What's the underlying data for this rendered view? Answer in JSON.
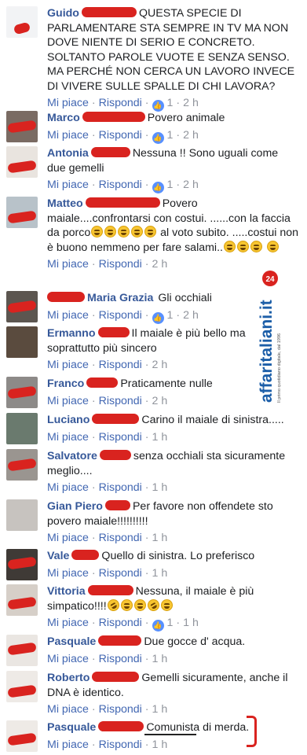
{
  "comments": [
    {
      "name": "Guido",
      "text": "QUESTA SPECIE DI PARLAMENTARE STA SEMPRE IN TV MA NON DOVE NIENTE DI SERIO E CONCRETO. SOLTANTO PAROLE VUOTE E SENZA SENSO. MA PERCHÉ NON CERCA UN LAVORO INVECE DI VIVERE SULLE SPALLE DI CHI LAVORA?",
      "like": "Mi piace",
      "reply": "Rispondi",
      "likes": "1",
      "time": "2 h"
    },
    {
      "name": "Marco",
      "text": "Povero animale",
      "like": "Mi piace",
      "reply": "Rispondi",
      "likes": "1",
      "time": "2 h"
    },
    {
      "name": "Antonia",
      "text": "Nessuna !! Sono uguali come due gemelli",
      "like": "Mi piace",
      "reply": "Rispondi",
      "likes": "1",
      "time": "2 h"
    },
    {
      "name": "Matteo",
      "text_a": "Povero maiale....confrontarsi con costui. ......con la faccia da porco",
      "text_b": "al voto subito. .....costui non è buono nemmeno per fare salami..",
      "like": "Mi piace",
      "reply": "Rispondi",
      "time": "2 h"
    },
    {
      "name": "Maria Grazia",
      "text": "Gli occhiali",
      "like": "Mi piace",
      "reply": "Rispondi",
      "likes": "1",
      "time": "2 h"
    },
    {
      "name": "Ermanno",
      "text": "Il maiale è più bello ma soprattutto più sincero",
      "like": "Mi piace",
      "reply": "Rispondi",
      "time": "2 h"
    },
    {
      "name": "Franco",
      "text": "Praticamente nulle",
      "like": "Mi piace",
      "reply": "Rispondi",
      "time": "2 h"
    },
    {
      "name": "Luciano",
      "text": "Carino il maiale di sinistra.....",
      "like": "Mi piace",
      "reply": "Rispondi",
      "time": "1 h"
    },
    {
      "name": "Salvatore",
      "text": "senza occhiali sta sicuramente meglio....",
      "like": "Mi piace",
      "reply": "Rispondi",
      "time": "1 h"
    },
    {
      "name": "Gian Piero",
      "text": "Per favore non offendete sto povero maiale!!!!!!!!!!",
      "like": "Mi piace",
      "reply": "Rispondi",
      "time": "1 h"
    },
    {
      "name": "Vale",
      "text": "Quello di sinistra. Lo preferisco",
      "like": "Mi piace",
      "reply": "Rispondi",
      "time": "1 h"
    },
    {
      "name": "Vittoria",
      "text": "Nessuna, il maiale è più simpatico!!!!",
      "like": "Mi piace",
      "reply": "Rispondi",
      "likes": "1",
      "time": "1 h"
    },
    {
      "name": "Pasquale",
      "text": "Due gocce d' acqua.",
      "like": "Mi piace",
      "reply": "Rispondi",
      "time": "1 h"
    },
    {
      "name": "Roberto",
      "text": "Gemelli sicuramente, anche il DNA è identico.",
      "like": "Mi piace",
      "reply": "Rispondi",
      "time": "1 h"
    },
    {
      "name": "Pasquale",
      "text": "Comunista di merda.",
      "like": "Mi piace",
      "reply": "Rispondi",
      "time": "1 h"
    }
  ],
  "logo": {
    "brand": "affaritaliani.it",
    "tagline": "Il primo quotidiano digitale, dal 1996",
    "badge": "24",
    "color_red": "#d9231f",
    "color_blue": "#1c5ea8"
  },
  "colors": {
    "name": "#365899",
    "link": "#4267b2",
    "meta": "#90949c",
    "text": "#1c1e21",
    "redaction": "#d9231f",
    "like_icon": "#5890ff"
  },
  "icons": {
    "like": "thumbs-up-icon",
    "emoji": "laughing-emoji-icon",
    "rofl": "rolling-laughing-emoji-icon"
  }
}
